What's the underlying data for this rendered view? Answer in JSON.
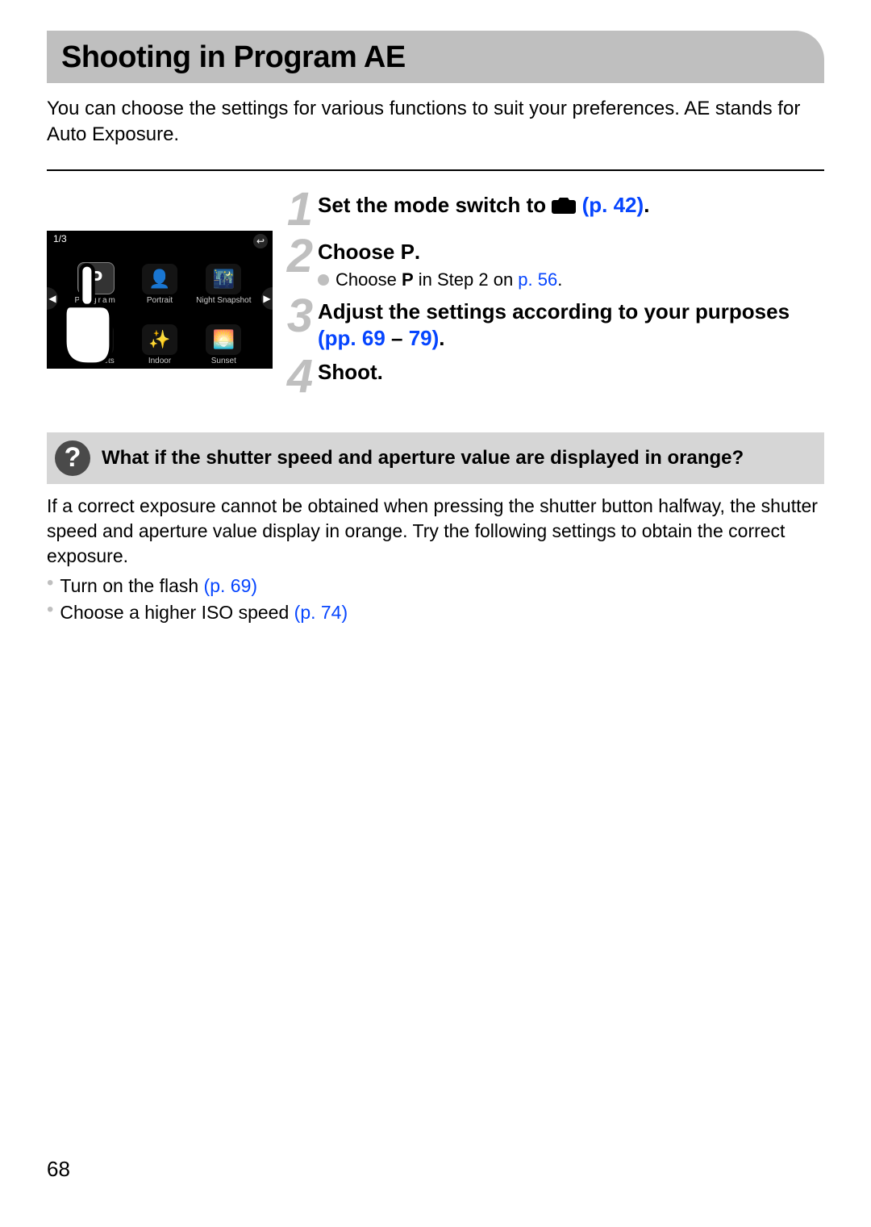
{
  "title": "Shooting in Program AE",
  "intro": "You can choose the settings for various functions to suit your preferences. AE stands for Auto Exposure.",
  "lcd": {
    "counter": "1/3",
    "modes": [
      {
        "icon": "P",
        "label": "Program",
        "selected": true
      },
      {
        "icon": "👤",
        "label": "Portrait"
      },
      {
        "icon": "🌃",
        "label": "Night Snapshot"
      },
      {
        "icon": "🐾",
        "label": "Kids&Pets"
      },
      {
        "icon": "✨",
        "label": "Indoor"
      },
      {
        "icon": "🌅",
        "label": "Sunset"
      }
    ]
  },
  "steps": {
    "s1": {
      "num": "1",
      "prefix": "Set the mode switch to ",
      "link": "(p. 42)",
      "suffix": "."
    },
    "s2": {
      "num": "2",
      "title_prefix": "Choose ",
      "title_suffix": ".",
      "sub_prefix": "Choose ",
      "sub_mid": " in Step 2 on ",
      "sub_link": "p. 56",
      "sub_suffix": "."
    },
    "s3": {
      "num": "3",
      "prefix": "Adjust the settings according to your purposes ",
      "link_open": "(pp. 69",
      "dash": " – ",
      "link_close": "79)",
      "suffix": "."
    },
    "s4": {
      "num": "4",
      "title": "Shoot."
    }
  },
  "question": {
    "mark": "?",
    "text": "What if the shutter speed and aperture value are displayed in orange?",
    "answer_para": "If a correct exposure cannot be obtained when pressing the shutter button halfway, the shutter speed and aperture value display in orange. Try the following settings to obtain the correct exposure.",
    "items": [
      {
        "text": "Turn on the flash ",
        "link": "(p. 69)"
      },
      {
        "text": "Choose a higher ISO speed ",
        "link": "(p. 74)"
      }
    ]
  },
  "page_number": "68"
}
